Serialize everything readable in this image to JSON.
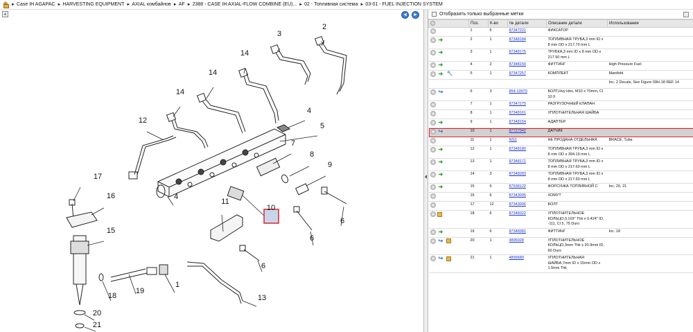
{
  "breadcrumb": [
    "Case IH AGAPAC",
    "HARVESTING EQUIPMENT",
    "AXIAL комбайнов",
    "AF",
    "2388 - CASE IH AXIAL-FLOW COMBINE (EU)...",
    "02 - Топливная система",
    "03-01 - FUEL INJECTION SYSTEM"
  ],
  "toolbar": {
    "expand_label": "+"
  },
  "nav": {
    "back": "◄",
    "forward": "►"
  },
  "filter": {
    "label": "Отобразить только выбранные метки"
  },
  "columns": [
    "Поз.",
    "К-во",
    "№ детали",
    "Описание детали",
    "Использование"
  ],
  "parts": [
    {
      "pos": "1",
      "qty": "6",
      "part": "87347221",
      "desc": "ФИКСАТОР",
      "usage": "",
      "icons": [
        "dot"
      ]
    },
    {
      "pos": "2",
      "qty": "1",
      "part": "87348184",
      "desc": "ТОПЛИВНАЯ ТРУБА,3 mm ID x 8 mm OD x 217.70 mm L",
      "usage": "",
      "icons": [
        "dot",
        "green"
      ]
    },
    {
      "pos": "3",
      "qty": "1",
      "part": "87348175",
      "desc": "ТРУБКА,3 mm ID x 8 mm OD x 217.50 mm L",
      "usage": "",
      "icons": [
        "dot",
        "green"
      ]
    },
    {
      "pos": "4",
      "qty": "2",
      "part": "87348150",
      "desc": "ФИТТИНГ",
      "usage": "High Pressure Fuel",
      "icons": [
        "dot",
        "green"
      ]
    },
    {
      "pos": "5",
      "qty": "1",
      "part": "87347257",
      "desc": "КОМПЛЕКТ",
      "usage": "Manifold",
      "icons": [
        "dot",
        "green",
        "wrench"
      ]
    },
    {
      "pos": "",
      "qty": "",
      "part": "",
      "desc": "",
      "usage": "Inc. 2 Decals, See Figure 09H-18 REF 14",
      "icons": []
    },
    {
      "pos": "6",
      "qty": "3",
      "part": "854-10070",
      "desc": "БОЛТ,Hvy Hex, M10 x 70mm, Cl 10.9",
      "usage": "",
      "icons": [
        "dot",
        "blue"
      ]
    },
    {
      "pos": "7",
      "qty": "1",
      "part": "87347275",
      "desc": "РАЗГРУЗОЧНЫЙ КЛАПАН",
      "usage": "",
      "icons": [
        "dot"
      ]
    },
    {
      "pos": "8",
      "qty": "1",
      "part": "87348161",
      "desc": "УПЛОТНИТЕЛЬНАЯ ШАЙБА",
      "usage": "",
      "icons": [
        "dot"
      ]
    },
    {
      "pos": "9",
      "qty": "1",
      "part": "87348154",
      "desc": "АДАПТЕР",
      "usage": "",
      "icons": [
        "dot",
        "green"
      ]
    },
    {
      "pos": "10",
      "qty": "1",
      "part": "87727942",
      "desc": "ДАТЧИК",
      "usage": "",
      "icons": [
        "dot",
        "blue"
      ],
      "selected": true
    },
    {
      "pos": "11",
      "qty": "1",
      "part": "NSS",
      "desc": "НЕ ПРОДАНА ОТДЕЛЬНАЯ",
      "usage": "BRACE, Tube",
      "icons": [
        "dot"
      ]
    },
    {
      "pos": "12",
      "qty": "1",
      "part": "87348180",
      "desc": "ТОПЛИВНАЯ ТРУБА,3 mm ID x 8 mm OD x 394.19 mm L",
      "usage": "",
      "icons": [
        "dot",
        "green"
      ]
    },
    {
      "pos": "13",
      "qty": "1",
      "part": "87348171",
      "desc": "ТОПЛИВНАЯ ТРУБА,3 mm ID x 8 mm OD x 217.60 mm L",
      "usage": "",
      "icons": [
        "dot",
        "green"
      ]
    },
    {
      "pos": "14",
      "qty": "3",
      "part": "87348283",
      "desc": "ТОПЛИВНАЯ ТРУБА,3 mm ID x 8 mm OD x 217.50 mm L",
      "usage": "",
      "icons": [
        "dot",
        "green"
      ]
    },
    {
      "pos": "15",
      "qty": "6",
      "part": "87538122",
      "desc": "ФОРСУНКА ТОПЛИВНОЙ С",
      "usage": "Inc. 20, 21",
      "icons": [
        "dot",
        "green"
      ]
    },
    {
      "pos": "16",
      "qty": "6",
      "part": "87343005",
      "desc": "ХОМУТ",
      "usage": "",
      "icons": [
        "dot"
      ]
    },
    {
      "pos": "17",
      "qty": "12",
      "part": "87343006",
      "desc": "БОЛТ",
      "usage": "",
      "icons": [
        "dot"
      ]
    },
    {
      "pos": "18",
      "qty": "6",
      "part": "87348322",
      "desc": "УПЛОТНИТЕЛЬНОЕ КОЛЬЦО,0.103\" Thk x 0.424\" ID, -111, Cl 5, 75 Duro",
      "usage": "",
      "icons": [
        "dot",
        "box"
      ]
    },
    {
      "pos": "19",
      "qty": "6",
      "part": "87348381",
      "desc": "ФИТТИНГ",
      "usage": "Inc. 18",
      "icons": [
        "dot",
        "green"
      ]
    },
    {
      "pos": "20",
      "qty": "1",
      "part": "4896928",
      "desc": "УПЛОТНИТЕЛЬНОЕ КОЛЬЦО,3mm Thk x 20.9mm ID, 60 Duro",
      "usage": "",
      "icons": [
        "dot",
        "blue",
        "box"
      ]
    },
    {
      "pos": "21",
      "qty": "1",
      "part": "4899689",
      "desc": "УПЛОТНИТЕЛЬНАЯ ШАЙБА,7mm ID x 15mm OD x 1.5mm Thk",
      "usage": "",
      "icons": [
        "dot",
        "blue",
        "box"
      ]
    }
  ],
  "diagram": {
    "callouts": [
      {
        "label": "2"
      },
      {
        "label": "3"
      },
      {
        "label": "14"
      },
      {
        "label": "14"
      },
      {
        "label": "14"
      },
      {
        "label": "4"
      },
      {
        "label": "5"
      },
      {
        "label": "12"
      },
      {
        "label": "7"
      },
      {
        "label": "8"
      },
      {
        "label": "9"
      },
      {
        "label": "17"
      },
      {
        "label": "16"
      },
      {
        "label": "4"
      },
      {
        "label": "10"
      },
      {
        "label": "11"
      },
      {
        "label": "6"
      },
      {
        "label": "6"
      },
      {
        "label": "15"
      },
      {
        "label": "6"
      },
      {
        "label": "1"
      },
      {
        "label": "18"
      },
      {
        "label": "19"
      },
      {
        "label": "13"
      },
      {
        "label": "20"
      },
      {
        "label": "21"
      }
    ],
    "highlight_color": "#d9262e"
  }
}
